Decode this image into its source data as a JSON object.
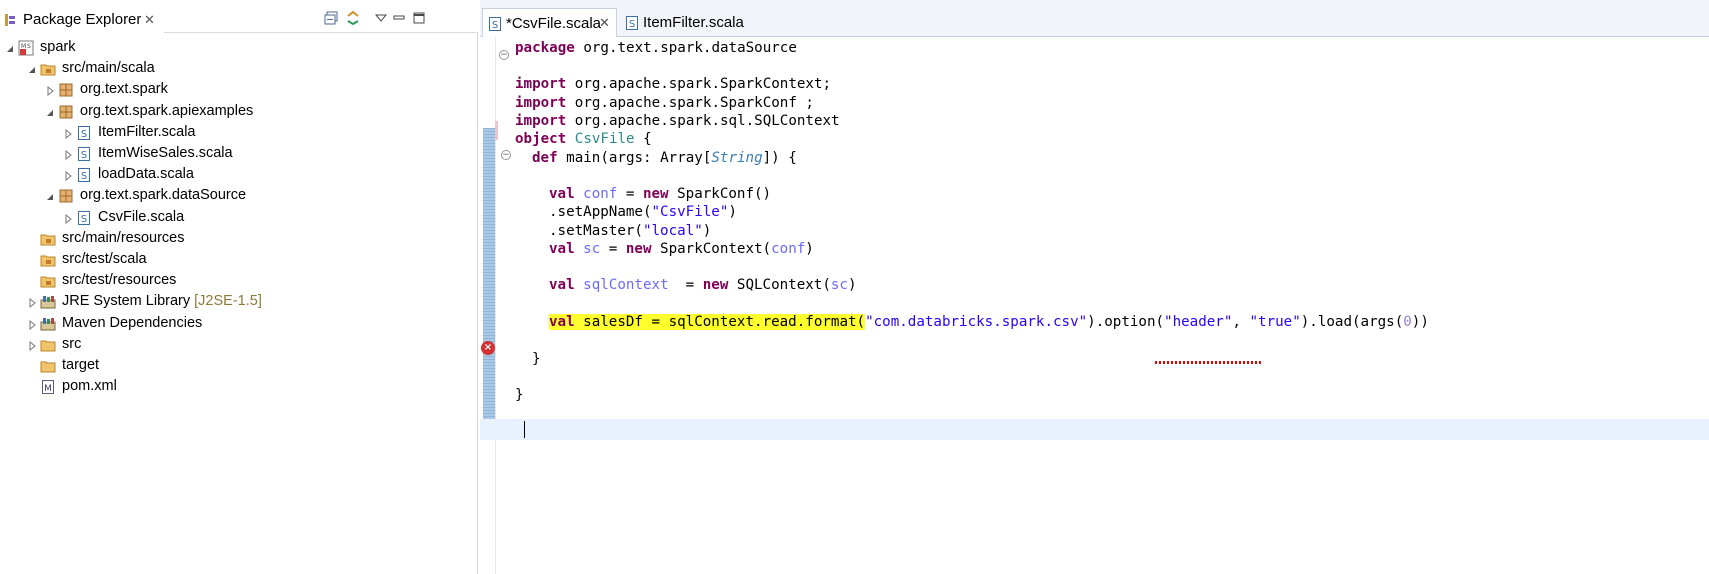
{
  "package_explorer": {
    "tab_label": "Package Explorer",
    "tree": [
      {
        "label": "spark",
        "icon": "project-icon",
        "level": 0,
        "state": "expanded"
      },
      {
        "label": "src/main/scala",
        "icon": "source-folder-icon",
        "level": 1,
        "state": "expanded"
      },
      {
        "label": "org.text.spark",
        "icon": "package-icon",
        "level": 2,
        "state": "collapsed"
      },
      {
        "label": "org.text.spark.apiexamples",
        "icon": "package-icon",
        "level": 2,
        "state": "expanded"
      },
      {
        "label": "ItemFilter.scala",
        "icon": "scala-file-icon",
        "level": 3,
        "state": "collapsed"
      },
      {
        "label": "ItemWiseSales.scala",
        "icon": "scala-file-icon",
        "level": 3,
        "state": "collapsed"
      },
      {
        "label": "loadData.scala",
        "icon": "scala-file-icon",
        "level": 3,
        "state": "collapsed"
      },
      {
        "label": "org.text.spark.dataSource",
        "icon": "package-icon",
        "level": 2,
        "state": "expanded"
      },
      {
        "label": "CsvFile.scala",
        "icon": "scala-file-icon",
        "level": 3,
        "state": "collapsed"
      },
      {
        "label": "src/main/resources",
        "icon": "source-folder-icon",
        "level": 1,
        "state": "none"
      },
      {
        "label": "src/test/scala",
        "icon": "source-folder-icon",
        "level": 1,
        "state": "none"
      },
      {
        "label": "src/test/resources",
        "icon": "source-folder-icon",
        "level": 1,
        "state": "none"
      },
      {
        "label": "JRE System Library",
        "decoration": "[J2SE-1.5]",
        "icon": "library-icon",
        "level": 1,
        "state": "collapsed"
      },
      {
        "label": "Maven Dependencies",
        "icon": "library-icon",
        "level": 1,
        "state": "collapsed"
      },
      {
        "label": "src",
        "icon": "folder-icon",
        "level": 1,
        "state": "collapsed"
      },
      {
        "label": "target",
        "icon": "folder-icon",
        "level": 1,
        "state": "none"
      },
      {
        "label": "pom.xml",
        "icon": "maven-file-icon",
        "level": 1,
        "state": "none"
      }
    ]
  },
  "editor": {
    "tabs": [
      {
        "label": "*CsvFile.scala",
        "active": true
      },
      {
        "label": "ItemFilter.scala",
        "active": false
      }
    ],
    "code": {
      "l1": {
        "kw": "package",
        "rest": " org.text.spark.dataSource"
      },
      "l2": {
        "kw": "import",
        "rest": " org.apache.spark.SparkContext;"
      },
      "l3": {
        "kw": "import",
        "rest": " org.apache.spark.SparkConf ;"
      },
      "l4": {
        "kw": "import",
        "rest": " org.apache.spark.sql.SQLContext"
      },
      "l5": {
        "kw": "object",
        "name": "CsvFile",
        "rest": " {"
      },
      "l6": {
        "kw": "def",
        "a": " main(args: Array[",
        "type": "String",
        "b": "]) {"
      },
      "l7": {
        "kw1": "val",
        "id": "conf",
        "eq": " = ",
        "kw2": "new",
        "rest": " SparkConf()"
      },
      "l8": {
        "a": ".setAppName(",
        "str": "\"CsvFile\"",
        "b": ")"
      },
      "l9": {
        "a": ".setMaster(",
        "str": "\"local\"",
        "b": ")"
      },
      "l10": {
        "kw1": "val",
        "id": "sc",
        "eq": " = ",
        "kw2": "new",
        "a": " SparkContext(",
        "id2": "conf",
        "b": ")"
      },
      "l11": {
        "kw1": "val",
        "id": "sqlContext",
        "eq": "  = ",
        "kw2": "new",
        "a": " SQLContext(",
        "id2": "sc",
        "b": ")"
      },
      "l12": {
        "kw": "val",
        "p1": " salesDf = ",
        "p2": "sqlContext",
        "p3": ".",
        "p4": "read",
        "p5": ".format(",
        "s1": "\"com.databricks.spark.csv\"",
        "p6": ").option(",
        "s2": "\"header\"",
        "p7": ", ",
        "s3": "\"true\"",
        "p8": ").load(args(",
        "num": "0",
        "p9": "))"
      },
      "l13": "}",
      "l14": "}"
    },
    "highlight_color": "#ffff2e"
  }
}
